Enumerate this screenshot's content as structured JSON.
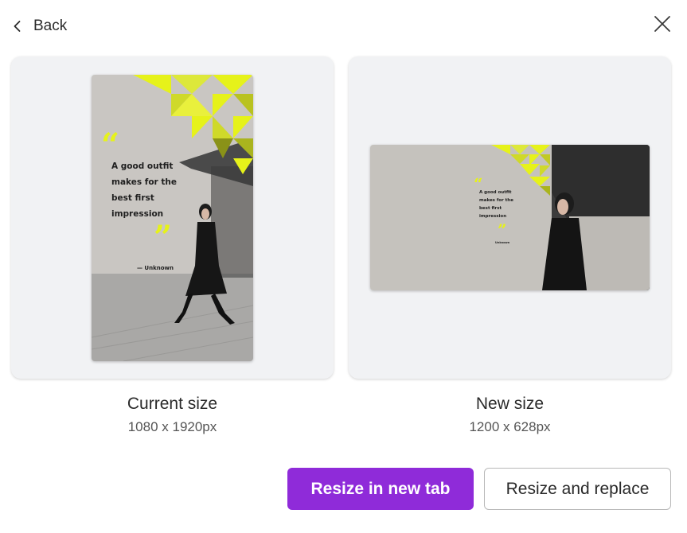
{
  "header": {
    "back_label": "Back"
  },
  "current": {
    "title": "Current size",
    "dimensions": "1080 x 1920px"
  },
  "new": {
    "title": "New size",
    "dimensions": "1200 x 628px"
  },
  "design": {
    "quote_line1": "A good outfit",
    "quote_line2": "makes for the",
    "quote_line3": "best first",
    "quote_line4": "impression",
    "author": "— Unknown",
    "author_small": "Unknown"
  },
  "actions": {
    "resize_new_tab": "Resize in new tab",
    "resize_replace": "Resize and replace"
  },
  "colors": {
    "accent": "#8f2bd9",
    "highlight_yellow": "#e6f21a"
  }
}
